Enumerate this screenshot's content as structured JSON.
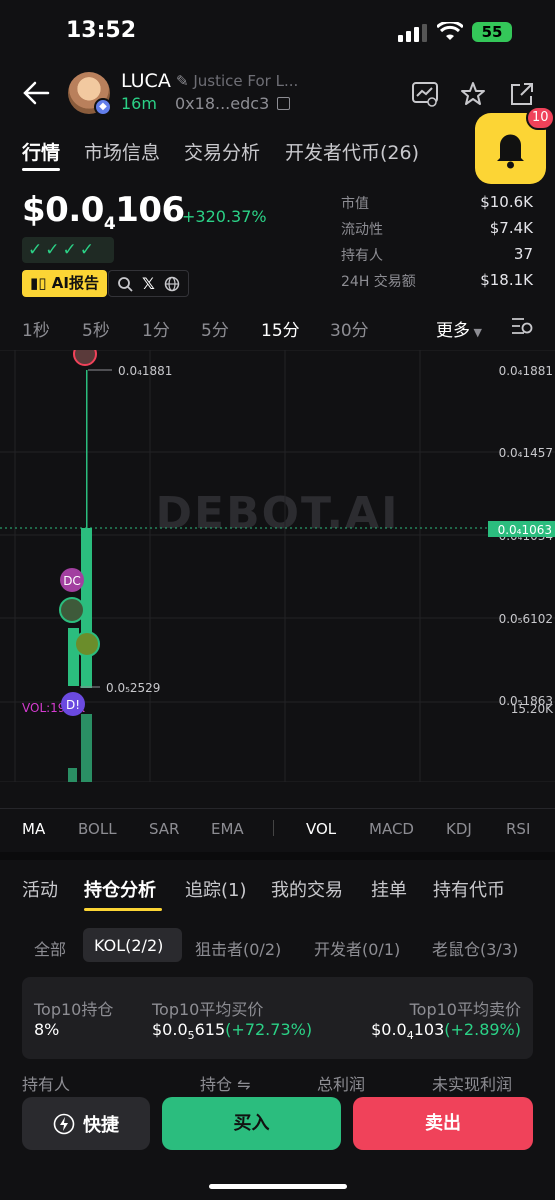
{
  "status": {
    "time": "13:52",
    "battery": "55"
  },
  "token": {
    "name": "LUCA",
    "description": "Justice For L...",
    "age": "16m",
    "address": "0x18...edc3"
  },
  "tabs": [
    "行情",
    "市场信息",
    "交易分析",
    "开发者代币(26)"
  ],
  "alerts": {
    "count": "10"
  },
  "price": {
    "main": "$0.0",
    "sub": "4",
    "rest": "106",
    "change": "+320.37%"
  },
  "checks": "✓✓✓✓",
  "ai_report": "AI报告",
  "stats": [
    {
      "label": "市值",
      "value": "$10.6K"
    },
    {
      "label": "流动性",
      "value": "$7.4K"
    },
    {
      "label": "持有人",
      "value": "37"
    },
    {
      "label": "24H 交易额",
      "value": "$18.1K"
    }
  ],
  "intervals": [
    "1秒",
    "5秒",
    "1分",
    "5分",
    "15分",
    "30分"
  ],
  "interval_active": "15分",
  "more": "更多",
  "chart": {
    "watermark": "DEBOT.AI",
    "high_label": "0.0₄1881",
    "low_label": "0.0₅2529",
    "axis": [
      "0.0₄1881",
      "0.0₄1457",
      "0.0₄1034",
      "0.0₅6102",
      "0.0₅1863"
    ],
    "current": "0.0₄1063",
    "vol_label": "VOL:19.5K",
    "vol_axis": "15.20K",
    "markers": [
      "DC",
      "D!"
    ],
    "colors": {
      "up": "#2bbd7e",
      "down": "#f0425a",
      "vol_text": "#d53bd0"
    }
  },
  "indicators": [
    "MA",
    "BOLL",
    "SAR",
    "EMA",
    "VOL",
    "MACD",
    "KDJ",
    "RSI"
  ],
  "subtabs": [
    "活动",
    "持仓分析",
    "追踪(1)",
    "我的交易",
    "挂单",
    "持有代币"
  ],
  "filters": [
    "全部",
    "KOL(2/2)",
    "狙击者(0/2)",
    "开发者(0/1)",
    "老鼠仓(3/3)"
  ],
  "summary": {
    "top10_hold_label": "Top10持仓",
    "top10_hold": "8%",
    "avg_buy_label": "Top10平均买价",
    "avg_buy_main": "$0.0",
    "avg_buy_sub": "5",
    "avg_buy_rest": "615",
    "avg_buy_change": "(+72.73%)",
    "avg_sell_label": "Top10平均卖价",
    "avg_sell_main": "$0.0",
    "avg_sell_sub": "4",
    "avg_sell_rest": "103",
    "avg_sell_change": "(+2.89%)"
  },
  "columns": [
    "持有人",
    "持仓 ⇋",
    "总利润",
    "未实现利润"
  ],
  "buttons": {
    "quick": "快捷",
    "buy": "买入",
    "sell": "卖出"
  }
}
